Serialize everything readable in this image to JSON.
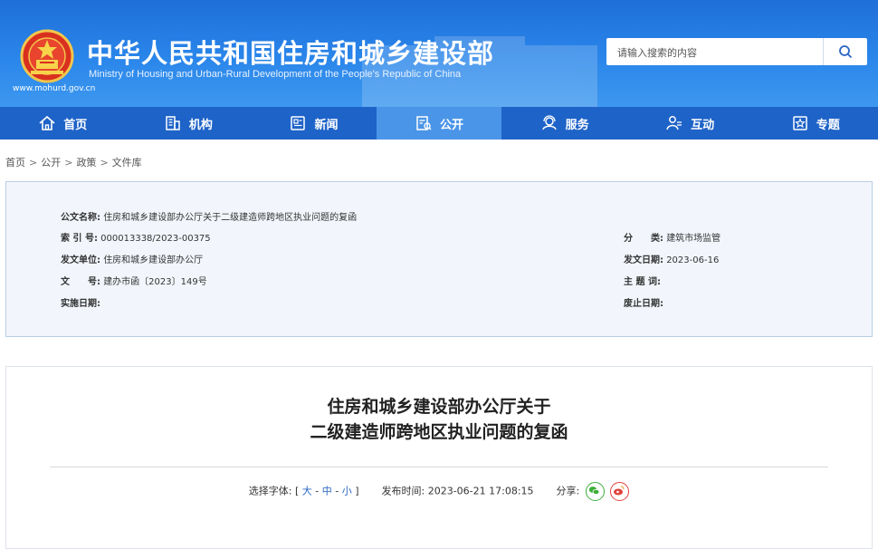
{
  "header": {
    "site_url": "www.mohurd.gov.cn",
    "title_cn": "中华人民共和国住房和城乡建设部",
    "title_en": "Ministry of Housing and Urban-Rural Development of the People's Republic of China",
    "search_placeholder": "请输入搜索的内容",
    "colors": {
      "header": "#2a86ea",
      "nav": "#1e63c8",
      "nav_active": "#4a95e8"
    }
  },
  "nav": {
    "items": [
      {
        "label": "首页",
        "icon": "home-icon"
      },
      {
        "label": "机构",
        "icon": "building-icon"
      },
      {
        "label": "新闻",
        "icon": "news-icon"
      },
      {
        "label": "公开",
        "icon": "document-icon",
        "active": true
      },
      {
        "label": "服务",
        "icon": "service-icon"
      },
      {
        "label": "互动",
        "icon": "interaction-icon"
      },
      {
        "label": "专题",
        "icon": "topic-icon"
      }
    ]
  },
  "breadcrumb": {
    "items": [
      "首页",
      "公开",
      "政策",
      "文件库"
    ],
    "separator": ">"
  },
  "meta": {
    "title_key": "公文名称:",
    "title_value": "住房和城乡建设部办公厅关于二级建造师跨地区执业问题的复函",
    "index_key": "索 引 号:",
    "index_value": "000013338/2023-00375",
    "issuer_key": "发文单位:",
    "issuer_value": "住房和城乡建设部办公厅",
    "docno_key": "文　　号:",
    "docno_value": "建办市函〔2023〕149号",
    "effective_key": "实施日期:",
    "effective_value": "",
    "category_key": "分　　类:",
    "category_value": "建筑市场监管",
    "date_key": "发文日期:",
    "date_value": "2023-06-16",
    "subject_key": "主 题 词:",
    "subject_value": "",
    "expiry_key": "废止日期:",
    "expiry_value": ""
  },
  "article": {
    "title_line1": "住房和城乡建设部办公厅关于",
    "title_line2": "二级建造师跨地区执业问题的复函",
    "font_label": "选择字体:",
    "bracket_open": "[",
    "font_large": "大",
    "font_medium": "中",
    "font_small": "小",
    "font_sep": " - ",
    "bracket_close": "]",
    "publish_label": "发布时间:",
    "publish_time": "2023-06-21 17:08:15",
    "share_label": "分享:",
    "share_icons": [
      "wechat-icon",
      "weibo-icon"
    ]
  }
}
